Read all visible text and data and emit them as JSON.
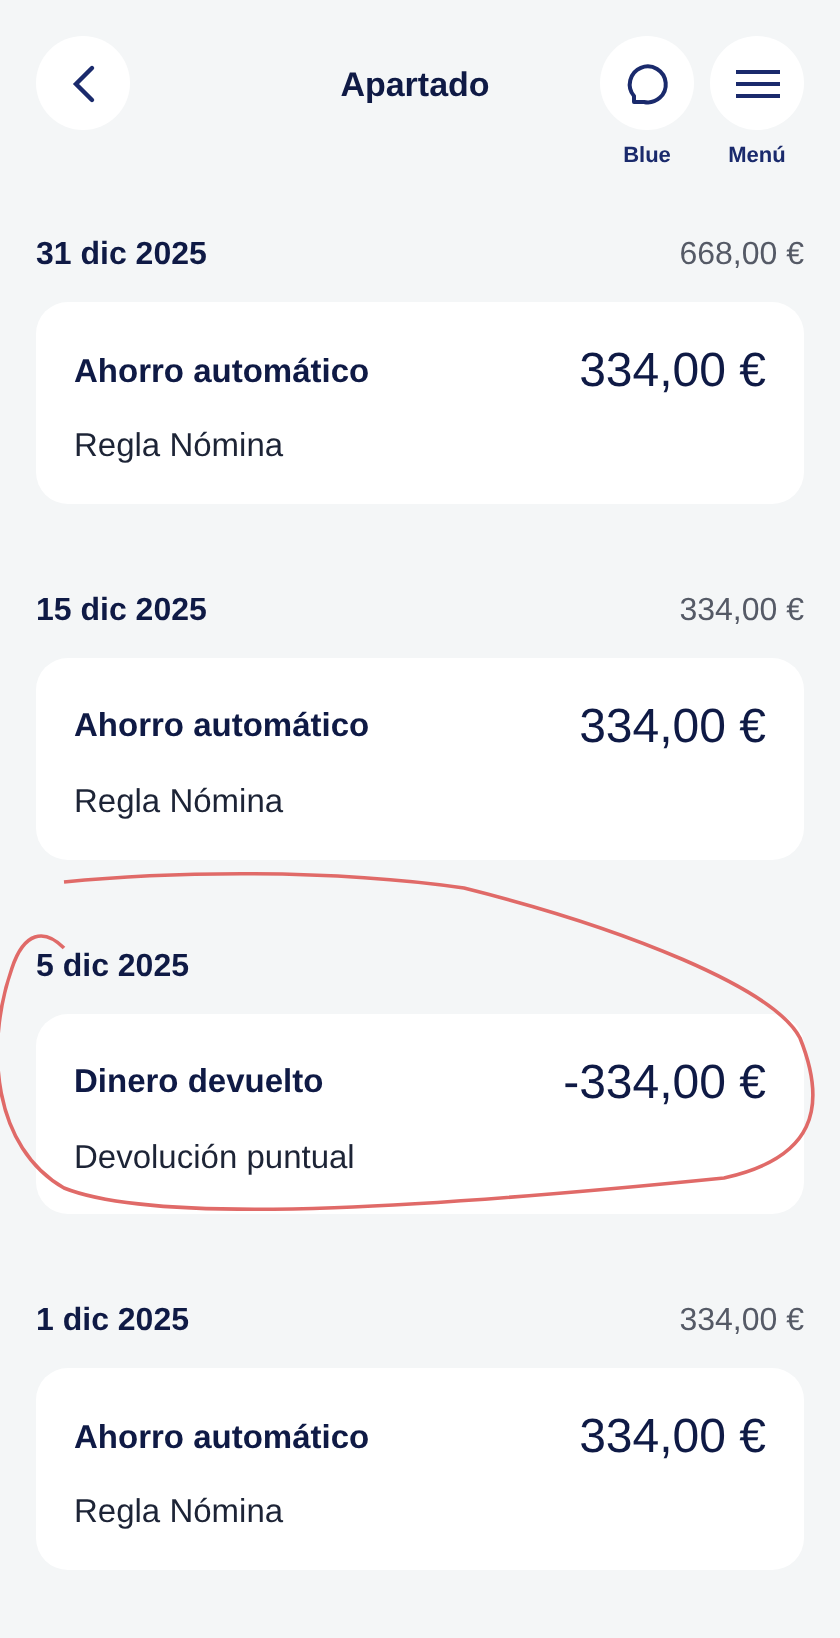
{
  "header": {
    "title": "Apartado",
    "actions": [
      {
        "kind": "chat",
        "label": "Blue"
      },
      {
        "kind": "menu",
        "label": "Menú"
      }
    ]
  },
  "groups": [
    {
      "date": "31 dic 2025",
      "total": "668,00 €",
      "highlighted": false,
      "items": [
        {
          "title": "Ahorro automático",
          "amount": "334,00 €",
          "subtitle": "Regla Nómina"
        }
      ]
    },
    {
      "date": "15 dic 2025",
      "total": "334,00 €",
      "highlighted": false,
      "items": [
        {
          "title": "Ahorro automático",
          "amount": "334,00 €",
          "subtitle": "Regla Nómina"
        }
      ]
    },
    {
      "date": "5 dic 2025",
      "highlighted": true,
      "items": [
        {
          "title": "Dinero devuelto",
          "amount": "-334,00 €",
          "subtitle": "Devolución puntual"
        }
      ]
    },
    {
      "date": "1 dic 2025",
      "total": "334,00 €",
      "highlighted": false,
      "items": [
        {
          "title": "Ahorro automático",
          "amount": "334,00 €",
          "subtitle": "Regla Nómina"
        }
      ]
    }
  ]
}
